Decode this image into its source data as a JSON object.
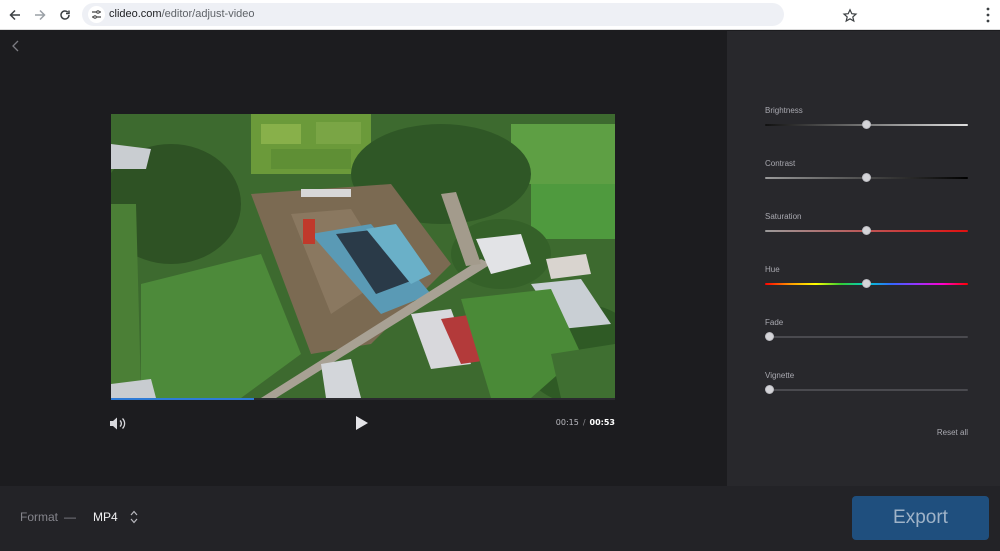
{
  "browser": {
    "url_host": "clideo.com",
    "url_path": "/editor/adjust-video"
  },
  "player": {
    "current_time": "00:15",
    "separator": "/",
    "total_time": "00:53",
    "progress_fraction": 0.283
  },
  "adjustments": [
    {
      "key": "brightness",
      "label": "Brightness",
      "value_fraction": 0.5
    },
    {
      "key": "contrast",
      "label": "Contrast",
      "value_fraction": 0.5
    },
    {
      "key": "saturation",
      "label": "Saturation",
      "value_fraction": 0.5
    },
    {
      "key": "hue",
      "label": "Hue",
      "value_fraction": 0.5
    },
    {
      "key": "fade",
      "label": "Fade",
      "value_fraction": 0.0
    },
    {
      "key": "vignette",
      "label": "Vignette",
      "value_fraction": 0.0
    }
  ],
  "reset_label": "Reset all",
  "format": {
    "label": "Format",
    "dash": "—",
    "value": "MP4"
  },
  "export_label": "Export",
  "colors": {
    "accent": "#2e7bd6",
    "export_bg": "#1f4f7e",
    "panel_bg": "#28282c",
    "app_bg": "#1c1c1f"
  }
}
